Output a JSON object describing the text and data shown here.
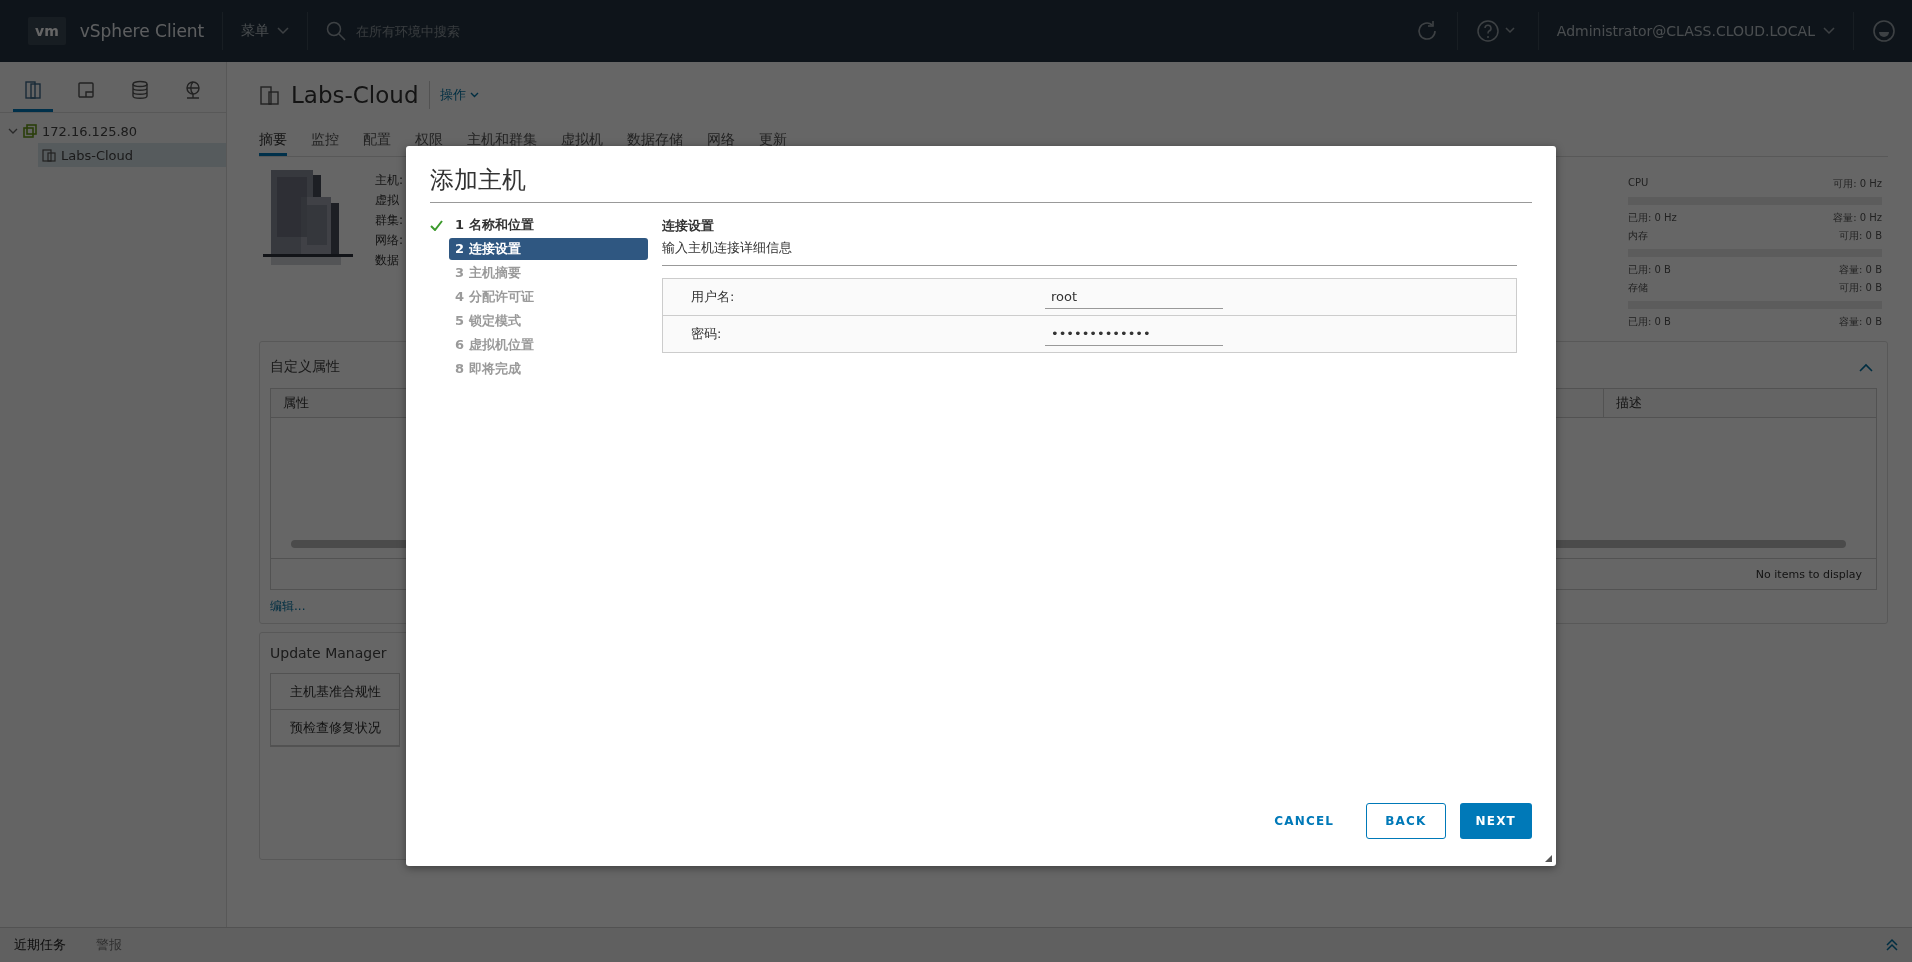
{
  "top_bar": {
    "logo": "vm",
    "product": "vSphere Client",
    "menu": "菜单",
    "search": {
      "placeholder": "在所有环境中搜索"
    },
    "user": "Administrator@CLASS.CLOUD.LOCAL"
  },
  "sidebar": {
    "views": [
      {
        "kind": "hosts",
        "selected": true
      },
      {
        "kind": "vms",
        "selected": false
      },
      {
        "kind": "storage",
        "selected": false
      },
      {
        "kind": "network",
        "selected": false
      }
    ],
    "tree": [
      {
        "label": "172.16.125.80",
        "expanded": true,
        "selected": false,
        "children": [
          {
            "label": "Labs-Cloud",
            "selected": true
          }
        ]
      }
    ]
  },
  "object": {
    "title": "Labs-Cloud",
    "actions": "操作"
  },
  "tabs": [
    {
      "label": "摘要",
      "selected": true
    },
    {
      "label": "监控",
      "selected": false
    },
    {
      "label": "配置",
      "selected": false
    },
    {
      "label": "权限",
      "selected": false
    },
    {
      "label": "主机和群集",
      "selected": false
    },
    {
      "label": "虚拟机",
      "selected": false
    },
    {
      "label": "数据存储",
      "selected": false
    },
    {
      "label": "网络",
      "selected": false
    },
    {
      "label": "更新",
      "selected": false
    }
  ],
  "summary": {
    "fields": [
      "主机:",
      "虚拟",
      "群集:",
      "网络:",
      "数据"
    ]
  },
  "resources": [
    {
      "name": "CPU",
      "free": "可用: 0 Hz",
      "used": "已用: 0 Hz",
      "capacity": "容量: 0 Hz"
    },
    {
      "name": "内存",
      "free": "可用: 0 B",
      "used": "已用: 0 B",
      "capacity": "容量: 0 B"
    },
    {
      "name": "存储",
      "free": "可用: 0 B",
      "used": "已用: 0 B",
      "capacity": "容量: 0 B"
    }
  ],
  "custom_attributes": {
    "title": "自定义属性",
    "expanded": true,
    "columns": [
      "属性",
      "描述"
    ],
    "empty": "No items to display",
    "edit_link": "编辑..."
  },
  "update_manager": {
    "title": "Update Manager",
    "buttons": [
      "主机基准合规性",
      "预检查修复状况"
    ]
  },
  "dialog": {
    "title": "添加主机",
    "steps": [
      {
        "label": "1 名称和位置",
        "completed": true,
        "selected": false,
        "disabled": false
      },
      {
        "label": "2 连接设置",
        "completed": false,
        "selected": true,
        "disabled": false
      },
      {
        "label": "3 主机摘要",
        "completed": false,
        "selected": false,
        "disabled": true
      },
      {
        "label": "4 分配许可证",
        "completed": false,
        "selected": false,
        "disabled": true
      },
      {
        "label": "5 锁定模式",
        "completed": false,
        "selected": false,
        "disabled": true
      },
      {
        "label": "6 虚拟机位置",
        "completed": false,
        "selected": false,
        "disabled": true
      },
      {
        "label": "8 即将完成",
        "completed": false,
        "selected": false,
        "disabled": true
      }
    ],
    "section_title": "连接设置",
    "section_subtitle": "输入主机连接详细信息",
    "fields": [
      {
        "label": "用户名:",
        "value": "root"
      },
      {
        "label": "密码:",
        "value": "•••••••••••••"
      }
    ],
    "buttons": [
      {
        "label": "CANCEL",
        "kind": "flat"
      },
      {
        "label": "BACK",
        "kind": "outline"
      },
      {
        "label": "NEXT",
        "kind": "primary"
      }
    ]
  },
  "bottom_bar": {
    "tabs": [
      {
        "label": "近期任务",
        "selected": true
      },
      {
        "label": "警报",
        "selected": false
      }
    ]
  }
}
